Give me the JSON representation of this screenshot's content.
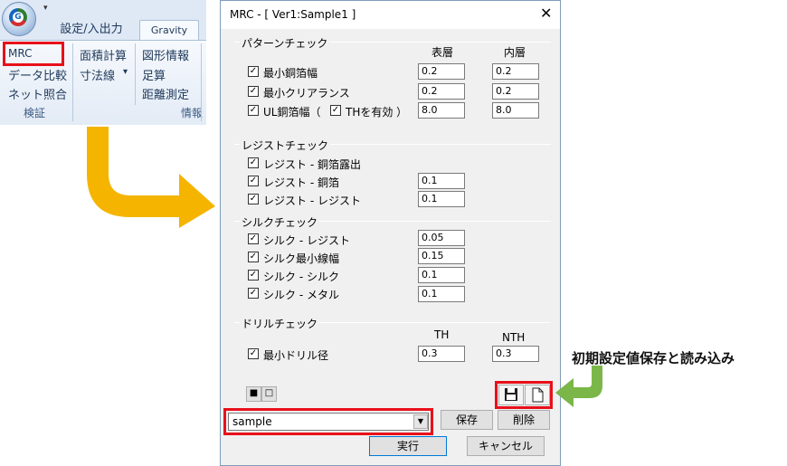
{
  "ribbon": {
    "app_logo_letter": "G",
    "tabs": [
      "設定/入出力",
      "Gravity"
    ],
    "groups": [
      {
        "items": [
          "MRC",
          "データ比較",
          "ネット照合"
        ],
        "label": "検証"
      },
      {
        "items": [
          "面積計算",
          "寸法線",
          "▾"
        ],
        "label": ""
      },
      {
        "items": [
          "図形情報",
          "足算",
          "距離測定"
        ],
        "label": "情報"
      }
    ]
  },
  "dialog": {
    "title": "MRC - [ Ver1:Sample1 ]",
    "close_glyph": "✕",
    "check_glyph": "✓",
    "pattern": {
      "heading": "パターンチェック",
      "col_headers": [
        "表層",
        "内層"
      ],
      "rows": [
        {
          "label": "最小銅箔幅",
          "v1": "0.2",
          "v2": "0.2"
        },
        {
          "label": "最小クリアランス",
          "v1": "0.2",
          "v2": "0.2"
        },
        {
          "label": "UL銅箔幅（",
          "sub_label": "THを有効 ）",
          "v1": "8.0",
          "v2": "8.0"
        }
      ]
    },
    "resist": {
      "heading": "レジストチェック",
      "rows": [
        {
          "label": "レジスト - 銅箔露出",
          "v1": ""
        },
        {
          "label": "レジスト - 銅箔",
          "v1": "0.1"
        },
        {
          "label": "レジスト - レジスト",
          "v1": "0.1"
        }
      ]
    },
    "silk": {
      "heading": "シルクチェック",
      "rows": [
        {
          "label": "シルク - レジスト",
          "v1": "0.05"
        },
        {
          "label": "シルク最小線幅",
          "v1": "0.15"
        },
        {
          "label": "シルク - シルク",
          "v1": "0.1"
        },
        {
          "label": "シルク - メタル",
          "v1": "0.1"
        }
      ]
    },
    "drill": {
      "heading": "ドリルチェック",
      "col_headers": [
        "TH",
        "NTH"
      ],
      "rows": [
        {
          "label": "最小ドリル径",
          "v1": "0.3",
          "v2": "0.3"
        }
      ]
    },
    "select_buttons": [
      "■",
      "□"
    ],
    "preset_value": "sample",
    "save_label": "保存",
    "delete_label": "削除",
    "run_label": "実行",
    "cancel_label": "キャンセル"
  },
  "annotation": "初期設定値保存と読み込み",
  "colors": {
    "highlight": "#e8101a",
    "arrow_yellow": "#f5b400",
    "arrow_green": "#7ab648"
  },
  "icons": [
    "save-icon",
    "new-file-icon",
    "dropdown-arrow-icon",
    "close-icon"
  ]
}
